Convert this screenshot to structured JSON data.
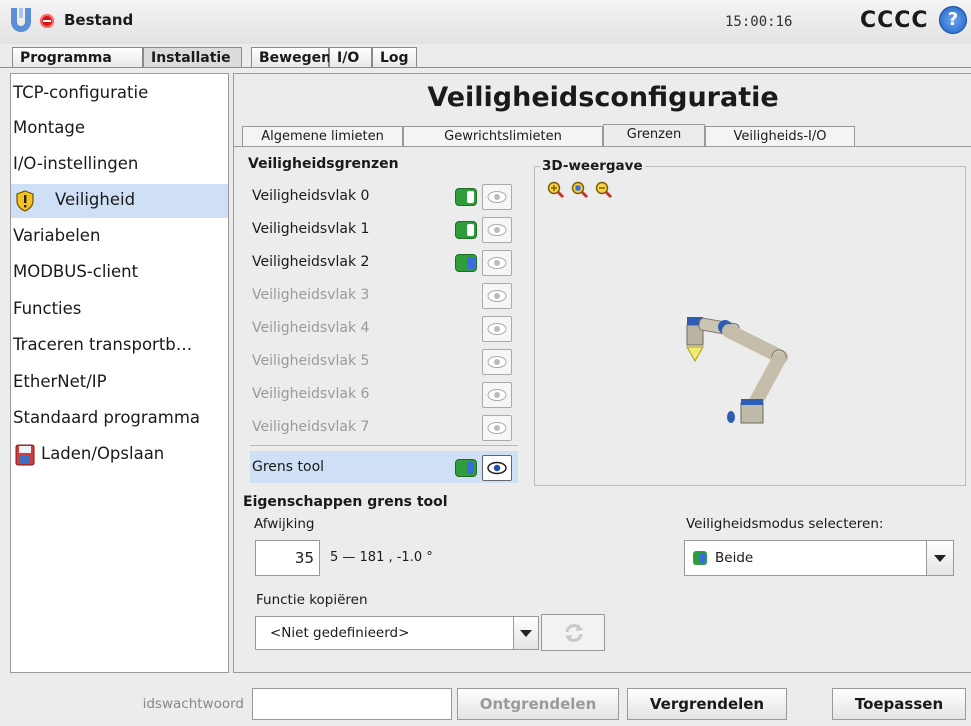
{
  "app": {
    "filename": "Bestand",
    "time": "15:00:16",
    "robot_name": "CCCC",
    "help_label": "?"
  },
  "main_tabs": [
    {
      "label": "Programma"
    },
    {
      "label": "Installatie"
    },
    {
      "label": "Bewegen"
    },
    {
      "label": "I/O"
    },
    {
      "label": "Log"
    }
  ],
  "sidebar": {
    "items": [
      {
        "label": "TCP-configuratie"
      },
      {
        "label": "Montage"
      },
      {
        "label": "I/O-instellingen"
      },
      {
        "label": "Veiligheid"
      },
      {
        "label": "Variabelen"
      },
      {
        "label": "MODBUS-client"
      },
      {
        "label": "Functies"
      },
      {
        "label": "Traceren transportb…"
      },
      {
        "label": "EtherNet/IP"
      },
      {
        "label": "Standaard programma"
      },
      {
        "label": "Laden/Opslaan"
      }
    ]
  },
  "page": {
    "title": "Veiligheidsconfiguratie",
    "subtabs": [
      {
        "label": "Algemene limieten"
      },
      {
        "label": "Gewrichtslimieten"
      },
      {
        "label": "Grenzen"
      },
      {
        "label": "Veiligheids-I/O"
      }
    ]
  },
  "boundaries": {
    "heading": "Veiligheidsgrenzen",
    "planes": [
      {
        "label": "Veiligheidsvlak 0"
      },
      {
        "label": "Veiligheidsvlak 1"
      },
      {
        "label": "Veiligheidsvlak 2"
      },
      {
        "label": "Veiligheidsvlak 3"
      },
      {
        "label": "Veiligheidsvlak 4"
      },
      {
        "label": "Veiligheidsvlak 5"
      },
      {
        "label": "Veiligheidsvlak 6"
      },
      {
        "label": "Veiligheidsvlak 7"
      }
    ],
    "tool_label": "Grens tool"
  },
  "view3d": {
    "label": "3D-weergave"
  },
  "tool_props": {
    "heading": "Eigenschappen grens tool",
    "deviation_label": "Afwijking",
    "deviation_value": "35",
    "deviation_range": "5 — 181 , -1.0 °",
    "copy_label": "Functie kopiëren",
    "copy_selected": "<Niet gedefinieerd>",
    "mode_label": "Veiligheidsmodus selecteren:",
    "mode_selected": "Beide"
  },
  "footer": {
    "password_placeholder": "idswachtwoord",
    "unlock_label": "Ontgrendelen",
    "lock_label": "Vergrendelen",
    "apply_label": "Toepassen"
  },
  "colors": {
    "selection": "#cfdff5",
    "toggle_green": "#2f9e3a",
    "accent_blue": "#3a6be0",
    "error_red": "#d21414"
  }
}
